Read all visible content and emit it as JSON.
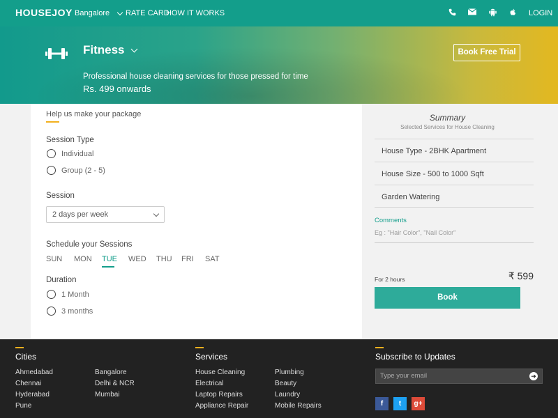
{
  "nav": {
    "logo": "HOUSEJOY",
    "city": "Bangalore",
    "links": [
      "RATE CARD",
      "HOW IT WORKS"
    ],
    "icons": [
      "phone-icon",
      "mail-icon",
      "android-icon",
      "apple-icon"
    ],
    "login": "LOGIN"
  },
  "hero": {
    "category": "Fitness",
    "subtitle": "Professional house cleaning services for those pressed for time",
    "price": "Rs. 499 onwards",
    "trial_button": "Book Free Trial"
  },
  "form": {
    "heading": "Help us make your package",
    "session_type_label": "Session Type",
    "session_types": [
      "Individual",
      "Group (2 - 5)"
    ],
    "session_label": "Session",
    "session_value": "2 days per week",
    "schedule_label": "Schedule your Sessions",
    "days": [
      "SUN",
      "MON",
      "TUE",
      "WED",
      "THU",
      "FRI",
      "SAT"
    ],
    "active_day": "TUE",
    "duration_label": "Duration",
    "durations": [
      "1 Month",
      "3 months"
    ]
  },
  "summary": {
    "title": "Summary",
    "subtitle": "Selected Services for House Cleaning",
    "rows": [
      "House Type - 2BHK Apartment",
      "House Size - 500 to 1000 Sqft",
      "Garden Watering"
    ],
    "comments_label": "Comments",
    "comments_placeholder": "Eg : \"Hair Color\", \"Nail Color\"",
    "duration_note": "For 2 hours",
    "price": "₹ 599",
    "book_button": "Book"
  },
  "footer": {
    "cities_heading": "Cities",
    "cities_col1": [
      "Ahmedabad",
      "Chennai",
      "Hyderabad",
      "Pune"
    ],
    "cities_col2": [
      "Bangalore",
      "Delhi & NCR",
      "Mumbai"
    ],
    "services_heading": "Services",
    "services_col1": [
      "House Cleaning",
      "Electrical",
      "Laptop Repairs",
      "Appliance Repair"
    ],
    "services_col2": [
      "Plumbing",
      "Beauty",
      "Laundry",
      "Mobile Repairs"
    ],
    "subscribe_heading": "Subscribe to Updates",
    "email_placeholder": "Type your email",
    "social": [
      "f",
      "t",
      "g+"
    ]
  },
  "colors": {
    "brand": "#139e8b",
    "accent": "#f2b01e",
    "book_button": "#2eab9a",
    "facebook": "#3b5998",
    "twitter": "#1da1f2",
    "google": "#dd4b39"
  }
}
